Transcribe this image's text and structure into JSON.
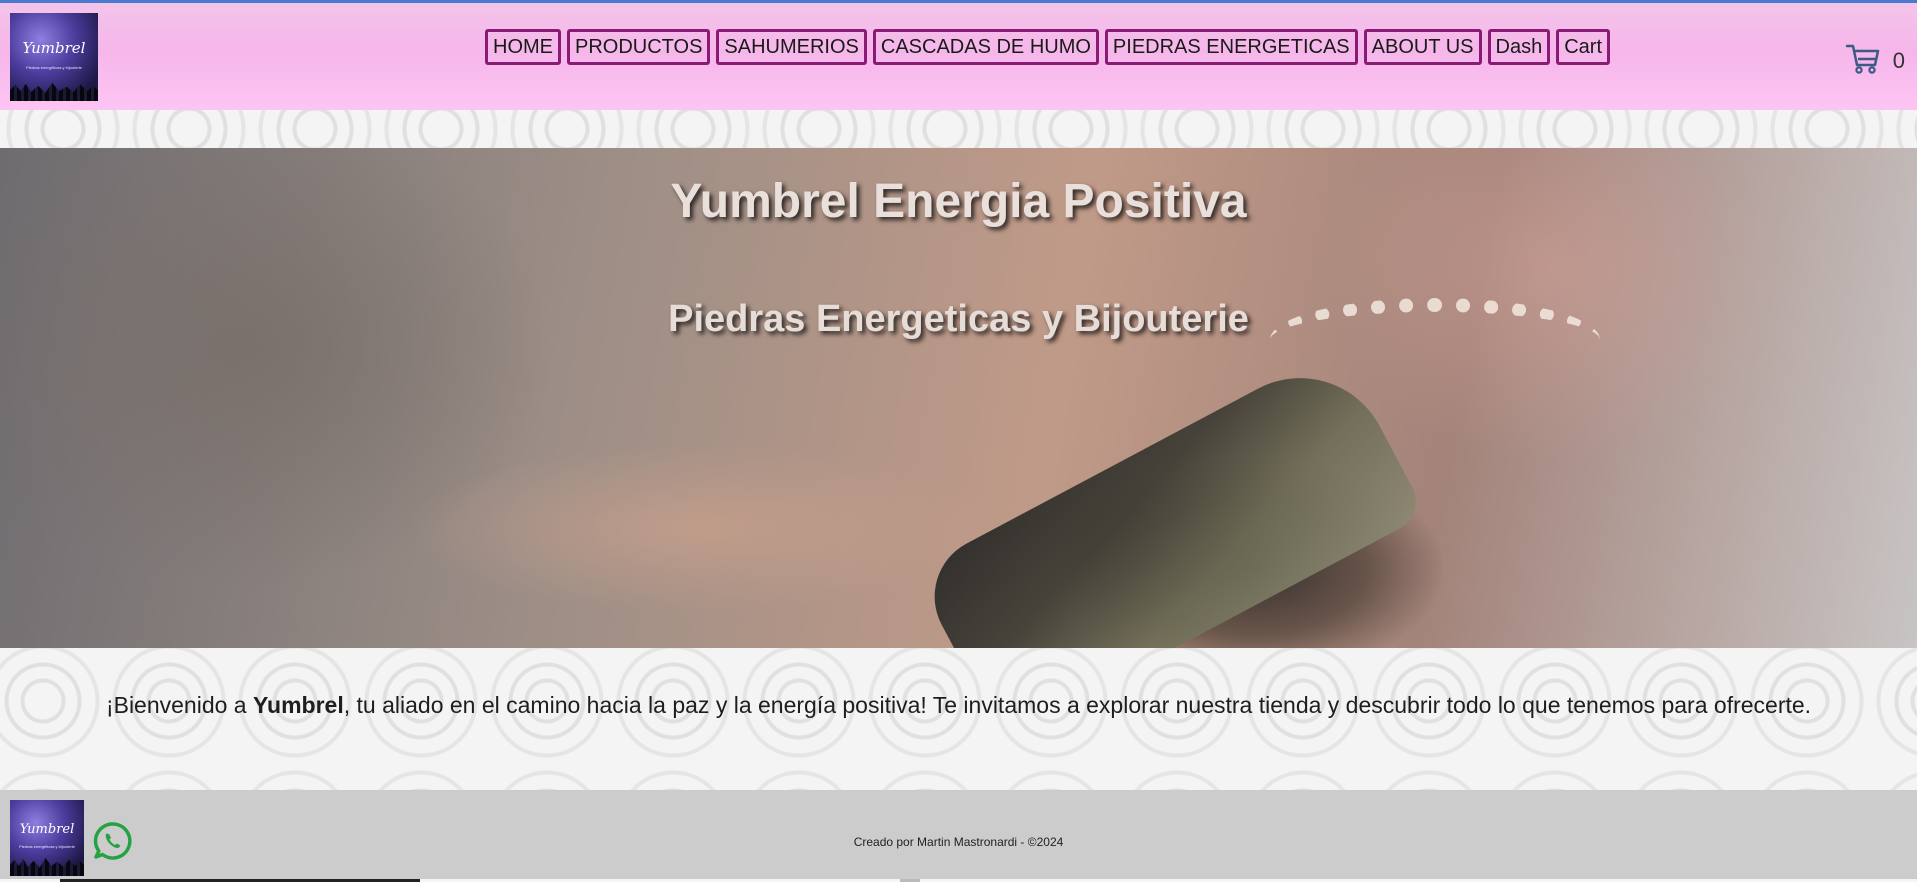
{
  "header": {
    "logo_text": "Yumbrel",
    "logo_subtext": "Piedras energéticas y bijouterie",
    "nav": [
      "HOME",
      "PRODUCTOS",
      "SAHUMERIOS",
      "CASCADAS DE HUMO",
      "PIEDRAS ENERGETICAS",
      "ABOUT US",
      "Dash",
      "Cart"
    ],
    "cart_count": "0",
    "cart_icon": "shopping-cart-icon"
  },
  "hero": {
    "title": "Yumbrel Energia Positiva",
    "subtitle": "Piedras Energeticas y Bijouterie"
  },
  "welcome": {
    "prefix": "¡Bienvenido a ",
    "brand": "Yumbrel",
    "suffix": ", tu aliado en el camino hacia la paz y la energía positiva! Te invitamos a explorar nuestra tienda y descubrir todo lo que tenemos para ofrecerte."
  },
  "footer": {
    "credit": "Creado por Martin Mastronardi - ©2024",
    "icons": [
      "instagram-icon",
      "whatsapp-icon"
    ]
  },
  "colors": {
    "nav_border": "#8a1b74",
    "header_pink": "#f6b6ea",
    "footer_bg": "#cccccc",
    "whatsapp_green": "#25a244"
  }
}
